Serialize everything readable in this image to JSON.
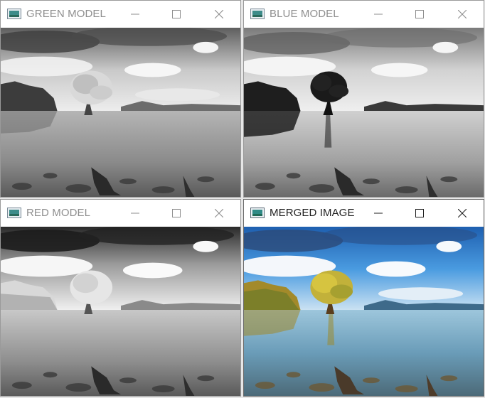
{
  "windows": [
    {
      "id": "green",
      "title": "GREEN MODEL",
      "active": false,
      "image_mode": "grayscale",
      "icon": "opencv-window-icon"
    },
    {
      "id": "blue",
      "title": "BLUE MODEL",
      "active": false,
      "image_mode": "grayscale-dark",
      "icon": "opencv-window-icon"
    },
    {
      "id": "red",
      "title": "RED MODEL",
      "active": false,
      "image_mode": "grayscale-bright",
      "icon": "opencv-window-icon"
    },
    {
      "id": "merged",
      "title": "MERGED IMAGE",
      "active": true,
      "image_mode": "color",
      "icon": "opencv-window-icon"
    }
  ],
  "controls": [
    "minimize-icon",
    "maximize-icon",
    "close-icon"
  ],
  "colors": {
    "inactive_title": "#8e8e8e",
    "active_title": "#1f1f1f",
    "sky_blue": "#3f8fd8",
    "tree_yellow": "#c9b53a"
  }
}
